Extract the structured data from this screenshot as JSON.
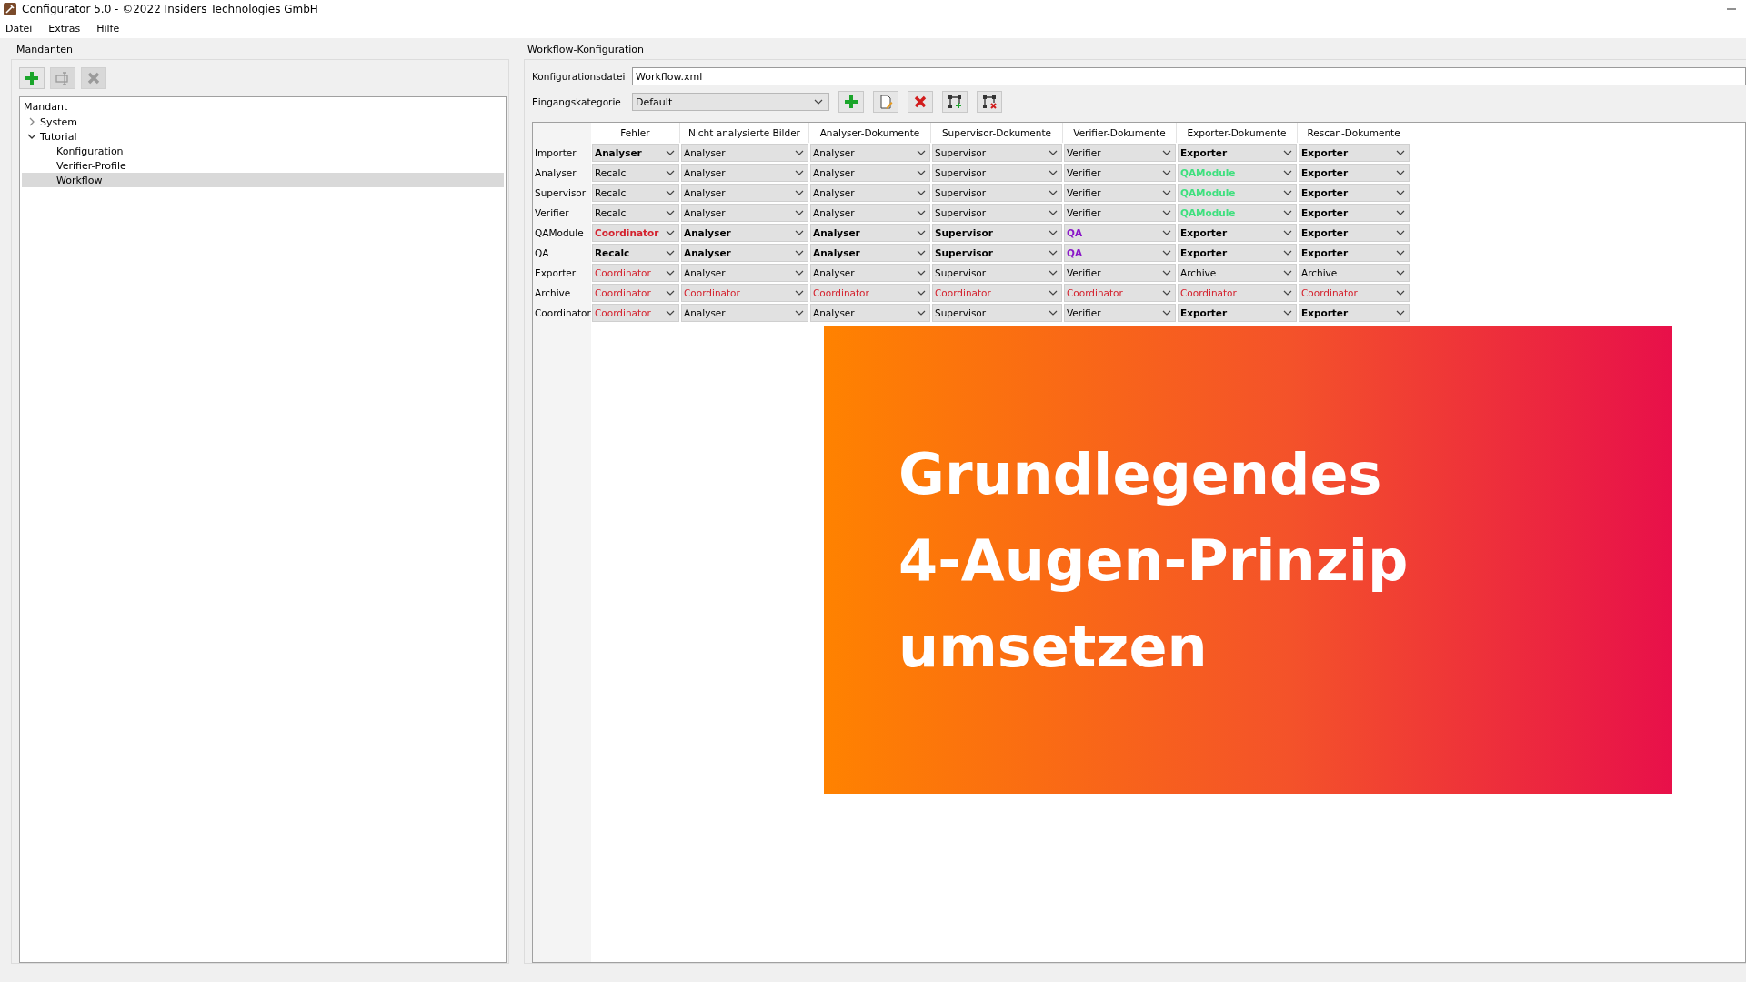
{
  "window": {
    "title": "Configurator 5.0 - ©2022 Insiders Technologies GmbH"
  },
  "menu": [
    "Datei",
    "Extras",
    "Hilfe"
  ],
  "mandanten": {
    "title": "Mandanten",
    "toolbar": [
      {
        "kind": "add",
        "disabled": false
      },
      {
        "kind": "rename",
        "disabled": true
      },
      {
        "kind": "delete",
        "disabled": true
      }
    ],
    "tree": {
      "header": "Mandant",
      "items": [
        {
          "label": "System",
          "expanded": false,
          "selected": false
        },
        {
          "label": "Tutorial",
          "expanded": true,
          "selected": false,
          "children": [
            {
              "label": "Konfiguration",
              "selected": false
            },
            {
              "label": "Verifier-Profile",
              "selected": false
            },
            {
              "label": "Workflow",
              "selected": true
            }
          ]
        }
      ]
    }
  },
  "workflow": {
    "title": "Workflow-Konfiguration",
    "config_file": {
      "label": "Konfigurationsdatei",
      "value": "Workflow.xml"
    },
    "category": {
      "label": "Eingangskategorie",
      "value": "Default"
    },
    "toolbar": [
      {
        "kind": "add"
      },
      {
        "kind": "edit"
      },
      {
        "kind": "delete"
      },
      {
        "kind": "link-add"
      },
      {
        "kind": "link-remove"
      }
    ],
    "table": {
      "columns": [
        "Fehler",
        "Nicht analysierte Bilder",
        "Analyser-Dokumente",
        "Supervisor-Dokumente",
        "Verifier-Dokumente",
        "Exporter-Dokumente",
        "Rescan-Dokumente"
      ],
      "rows": [
        {
          "name": "Importer",
          "cells": [
            {
              "value": "Analyser",
              "kind": "bold"
            },
            {
              "value": "Analyser",
              "kind": "plain"
            },
            {
              "value": "Analyser",
              "kind": "plain"
            },
            {
              "value": "Supervisor",
              "kind": "plain"
            },
            {
              "value": "Verifier",
              "kind": "plain"
            },
            {
              "value": "Exporter",
              "kind": "bold"
            },
            {
              "value": "Exporter",
              "kind": "bold"
            }
          ]
        },
        {
          "name": "Analyser",
          "cells": [
            {
              "value": "Recalc",
              "kind": "plain"
            },
            {
              "value": "Analyser",
              "kind": "plain"
            },
            {
              "value": "Analyser",
              "kind": "plain"
            },
            {
              "value": "Supervisor",
              "kind": "plain"
            },
            {
              "value": "Verifier",
              "kind": "plain"
            },
            {
              "value": "QAModule",
              "kind": "green"
            },
            {
              "value": "Exporter",
              "kind": "bold"
            }
          ]
        },
        {
          "name": "Supervisor",
          "cells": [
            {
              "value": "Recalc",
              "kind": "plain"
            },
            {
              "value": "Analyser",
              "kind": "plain"
            },
            {
              "value": "Analyser",
              "kind": "plain"
            },
            {
              "value": "Supervisor",
              "kind": "plain"
            },
            {
              "value": "Verifier",
              "kind": "plain"
            },
            {
              "value": "QAModule",
              "kind": "green"
            },
            {
              "value": "Exporter",
              "kind": "bold"
            }
          ]
        },
        {
          "name": "Verifier",
          "cells": [
            {
              "value": "Recalc",
              "kind": "plain"
            },
            {
              "value": "Analyser",
              "kind": "plain"
            },
            {
              "value": "Analyser",
              "kind": "plain"
            },
            {
              "value": "Supervisor",
              "kind": "plain"
            },
            {
              "value": "Verifier",
              "kind": "plain"
            },
            {
              "value": "QAModule",
              "kind": "green"
            },
            {
              "value": "Exporter",
              "kind": "bold"
            }
          ]
        },
        {
          "name": "QAModule",
          "cells": [
            {
              "value": "Coordinator",
              "kind": "red-bold"
            },
            {
              "value": "Analyser",
              "kind": "bold"
            },
            {
              "value": "Analyser",
              "kind": "bold"
            },
            {
              "value": "Supervisor",
              "kind": "bold"
            },
            {
              "value": "QA",
              "kind": "purple"
            },
            {
              "value": "Exporter",
              "kind": "bold"
            },
            {
              "value": "Exporter",
              "kind": "bold"
            }
          ]
        },
        {
          "name": "QA",
          "cells": [
            {
              "value": "Recalc",
              "kind": "bold"
            },
            {
              "value": "Analyser",
              "kind": "bold"
            },
            {
              "value": "Analyser",
              "kind": "bold"
            },
            {
              "value": "Supervisor",
              "kind": "bold"
            },
            {
              "value": "QA",
              "kind": "purple"
            },
            {
              "value": "Exporter",
              "kind": "bold"
            },
            {
              "value": "Exporter",
              "kind": "bold"
            }
          ]
        },
        {
          "name": "Exporter",
          "cells": [
            {
              "value": "Coordinator",
              "kind": "red"
            },
            {
              "value": "Analyser",
              "kind": "plain"
            },
            {
              "value": "Analyser",
              "kind": "plain"
            },
            {
              "value": "Supervisor",
              "kind": "plain"
            },
            {
              "value": "Verifier",
              "kind": "plain"
            },
            {
              "value": "Archive",
              "kind": "plain"
            },
            {
              "value": "Archive",
              "kind": "plain"
            }
          ]
        },
        {
          "name": "Archive",
          "cells": [
            {
              "value": "Coordinator",
              "kind": "red"
            },
            {
              "value": "Coordinator",
              "kind": "red"
            },
            {
              "value": "Coordinator",
              "kind": "red"
            },
            {
              "value": "Coordinator",
              "kind": "red"
            },
            {
              "value": "Coordinator",
              "kind": "red"
            },
            {
              "value": "Coordinator",
              "kind": "red"
            },
            {
              "value": "Coordinator",
              "kind": "red"
            }
          ]
        },
        {
          "name": "Coordinator",
          "cells": [
            {
              "value": "Coordinator",
              "kind": "red"
            },
            {
              "value": "Analyser",
              "kind": "plain"
            },
            {
              "value": "Analyser",
              "kind": "plain"
            },
            {
              "value": "Supervisor",
              "kind": "plain"
            },
            {
              "value": "Verifier",
              "kind": "plain"
            },
            {
              "value": "Exporter",
              "kind": "bold"
            },
            {
              "value": "Exporter",
              "kind": "bold"
            }
          ]
        }
      ]
    }
  },
  "banner": {
    "lines": [
      "Grundlegendes",
      "4-Augen-Prinzip",
      "umsetzen"
    ]
  }
}
